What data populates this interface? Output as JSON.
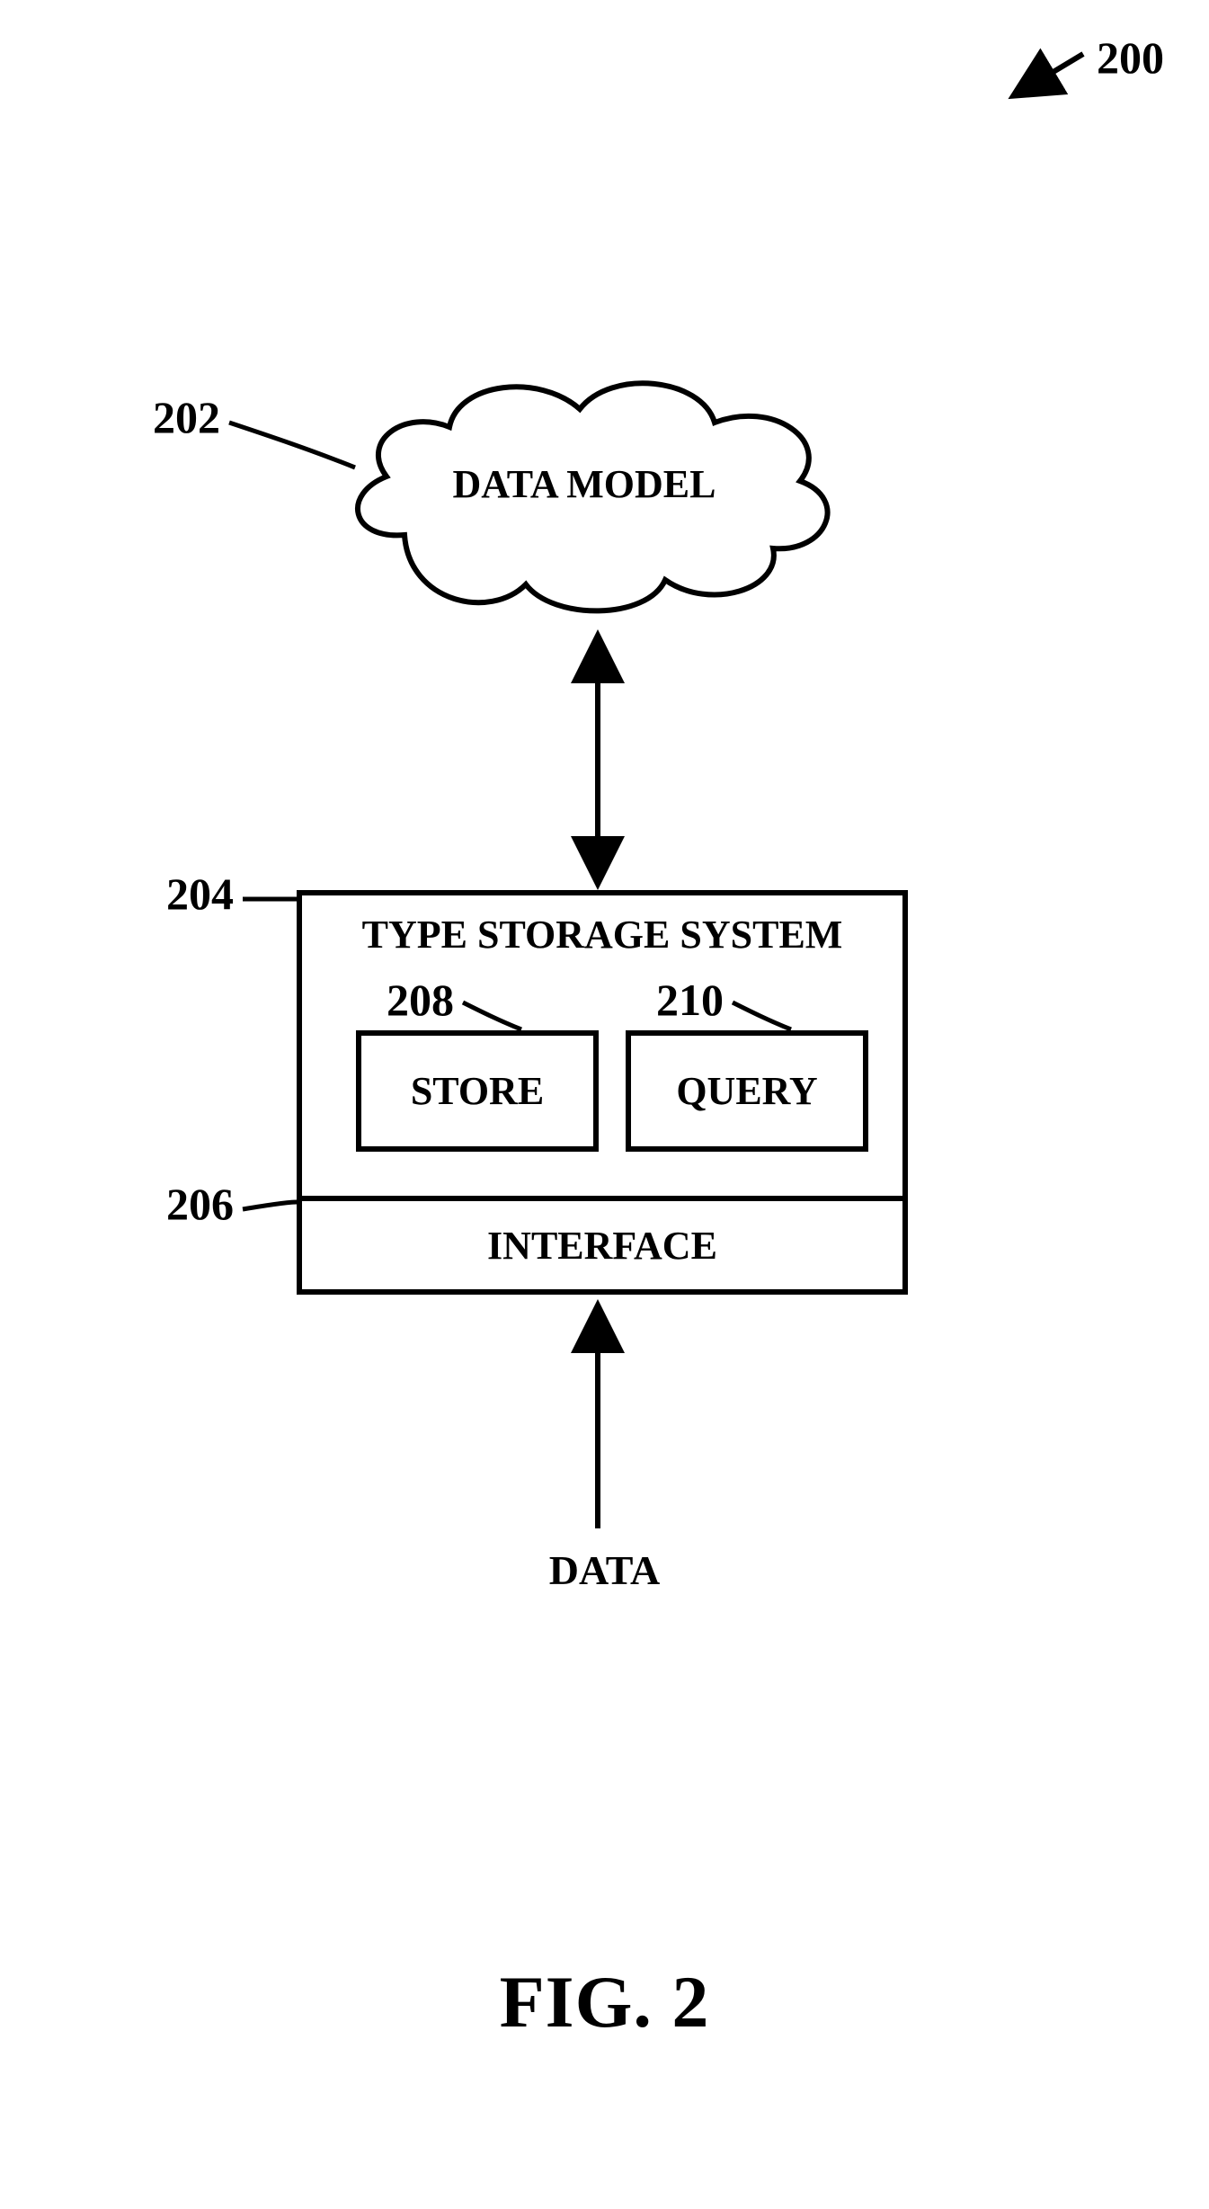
{
  "figure": {
    "caption": "FIG. 2",
    "ref_overall": "200",
    "components": {
      "cloud": {
        "ref": "202",
        "label": "DATA MODEL"
      },
      "tss": {
        "ref": "204",
        "title": "TYPE STORAGE SYSTEM"
      },
      "store": {
        "ref": "208",
        "label": "STORE"
      },
      "query": {
        "ref": "210",
        "label": "QUERY"
      },
      "interface": {
        "ref": "206",
        "label": "INTERFACE"
      }
    },
    "data_label": "DATA"
  }
}
